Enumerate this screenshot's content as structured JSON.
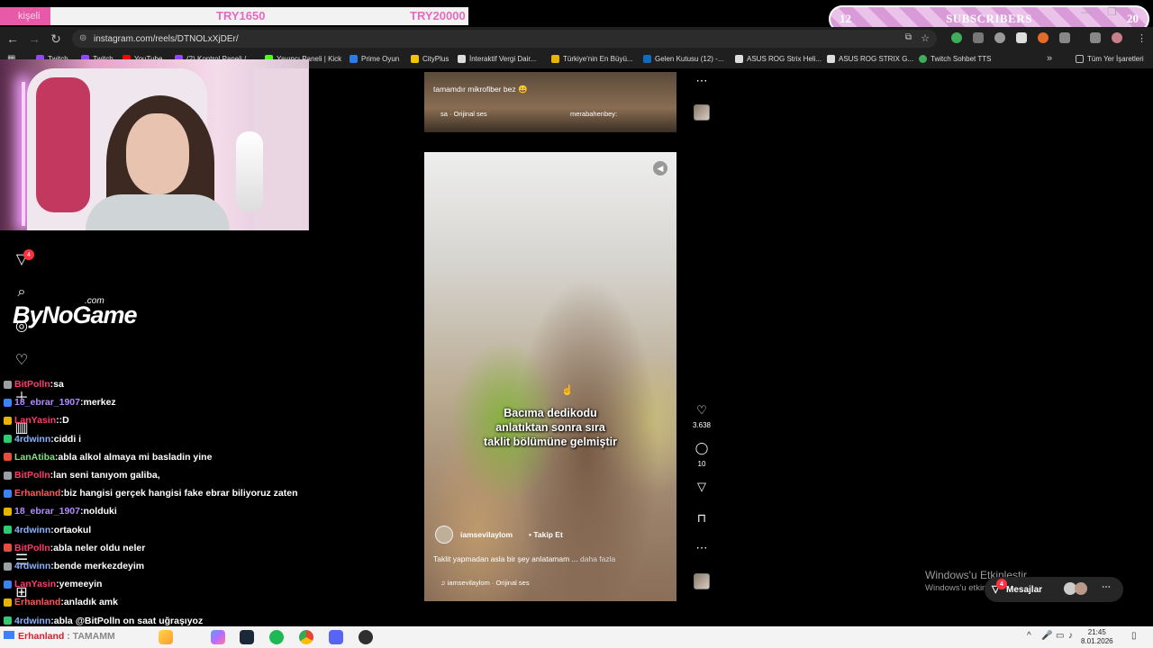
{
  "overlay": {
    "donation_label": "kişeli",
    "goal_current": "TRY1650",
    "goal_target": "TRY20000",
    "subs_current": "12",
    "subs_label": "SUBSCRIBERS",
    "subs_target": "20"
  },
  "browser": {
    "url": "instagram.com/reels/DTNOLxXjDEr/",
    "bookmarks": [
      "Twitch",
      "Twitch",
      "YouTube",
      "(2) Kontrol Paneli /...",
      "Yayıncı Paneli | Kick",
      "Prime Oyun",
      "CityPlus",
      "İnteraktif Vergi Dair...",
      "Türkiye'nin En Büyü...",
      "Gelen Kutusu (12) -...",
      "ASUS ROG Strix Heli...",
      "ASUS ROG STRIX G...",
      "Twitch Sohbet TTS"
    ],
    "all_bookmarks": "Tüm Yer İşaretleri"
  },
  "logo": {
    "main": "ByNoGame",
    "suffix": ".com"
  },
  "sidebar": {
    "notif_badge": "4"
  },
  "chat": [
    {
      "user": "BitPolln",
      "color": "#ff3b6b",
      "text": "sa"
    },
    {
      "user": "18_ebrar_1907",
      "color": "#b28cff",
      "text": "merkez"
    },
    {
      "user": "LanYasin",
      "color": "#ff3b6b",
      "text": ":D"
    },
    {
      "user": "4rdwinn",
      "color": "#8ab4ff",
      "text": "ciddi i"
    },
    {
      "user": "LanAtiba",
      "color": "#7fe07f",
      "text": "abla alkol almaya mi basladin yine"
    },
    {
      "user": "BitPolln",
      "color": "#ff3b6b",
      "text": "lan seni tanıyom galiba,"
    },
    {
      "user": "Erhanland",
      "color": "#ff5a5a",
      "text": "biz hangisi gerçek hangisi fake ebrar biliyoruz zaten"
    },
    {
      "user": "18_ebrar_1907",
      "color": "#b28cff",
      "text": "nolduki"
    },
    {
      "user": "4rdwinn",
      "color": "#8ab4ff",
      "text": "ortaokul"
    },
    {
      "user": "BitPolln",
      "color": "#ff3b6b",
      "text": "abla neler oldu neler"
    },
    {
      "user": "4rdwinn",
      "color": "#8ab4ff",
      "text": "bende merkezdeyim"
    },
    {
      "user": "LanYasin",
      "color": "#ff3b6b",
      "text": "yemeeyin"
    },
    {
      "user": "Erhanland",
      "color": "#ff5a5a",
      "text": "anladık amk"
    },
    {
      "user": "4rdwinn",
      "color": "#8ab4ff",
      "text": "abla @BitPolln on saat uğraşıyoz"
    }
  ],
  "reel_prev": {
    "caption": "tamamdır mikrofiber bez 😄",
    "audio": "sa · Orijinal ses",
    "audio2": "merabahenbey:"
  },
  "reel": {
    "overlay_line1": "Bacıma dedikodu",
    "overlay_line2": "anlatıktan sonra sıra",
    "overlay_line3": "taklit bölümüne gelmiştir",
    "username": "iamsevilaylom",
    "follow": "Takip Et",
    "description": "Taklit yapmadan asla bir şey anlatamam ...",
    "more": "daha fazla",
    "audio": "iamsevilaylom · Orijinal ses",
    "likes": "3.638",
    "comments": "10"
  },
  "windows": {
    "activate_title": "Windows'u Etkinleştir",
    "activate_sub": "Windows'u etkinleştirmek için Ayarlar'a gidin."
  },
  "messages": {
    "label": "Mesajlar",
    "badge": "4"
  },
  "taskbar": {
    "chat_user": "Erhanland",
    "chat_text": ": TAMAMM",
    "time": "21:45",
    "date": "8.01.2026"
  }
}
